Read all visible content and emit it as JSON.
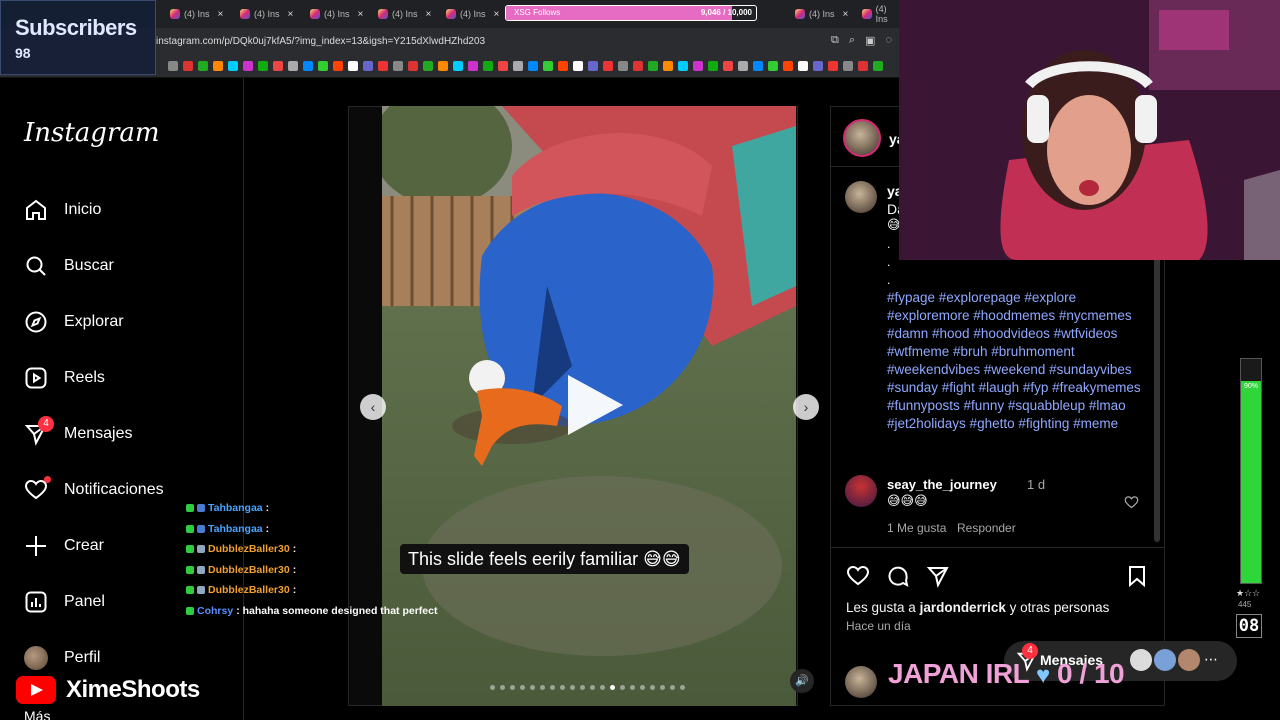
{
  "overlay": {
    "subscribers_label": "Subscribers",
    "subscribers_count": "98",
    "follows_goal_label": "XSG Follows",
    "follows_goal_value": "9,046 / 10,000",
    "follows_goal_fraction": 0.9046,
    "youtube_name": "XimeShoots",
    "japan_label": "JAPAN IRL",
    "japan_progress": "0 / 10",
    "meter_percent": "90%",
    "meter_value": "445",
    "meter_counter": "08"
  },
  "browser": {
    "tabs": [
      {
        "label": "(4) Ins"
      },
      {
        "label": "(4) Ins"
      },
      {
        "label": "(4) Ins"
      },
      {
        "label": "(4) Ins"
      },
      {
        "label": "(4) Ins"
      },
      {
        "label": "(4) Ins"
      },
      {
        "label": "(4) Ins"
      },
      {
        "label": "(4) Ins"
      },
      {
        "label": "(4) Ins"
      },
      {
        "label": "(4) Ins"
      }
    ],
    "url": "instagram.com/p/DQk0uj7kfA5/?img_index=13&igsh=Y215dXlwdHZhd203"
  },
  "sidebar": {
    "logo": "Instagram",
    "items": [
      {
        "label": "Inicio",
        "icon": "home-icon"
      },
      {
        "label": "Buscar",
        "icon": "search-icon"
      },
      {
        "label": "Explorar",
        "icon": "compass-icon"
      },
      {
        "label": "Reels",
        "icon": "reels-icon"
      },
      {
        "label": "Mensajes",
        "icon": "messenger-icon",
        "badge": "4"
      },
      {
        "label": "Notificaciones",
        "icon": "heart-icon"
      },
      {
        "label": "Crear",
        "icon": "plus-icon"
      },
      {
        "label": "Panel",
        "icon": "chart-icon"
      },
      {
        "label": "Perfil",
        "icon": "avatar"
      },
      {
        "label": "Más",
        "icon": "menu-icon"
      }
    ]
  },
  "chat": [
    {
      "user": "Tahbangaa",
      "text": ":",
      "color": "#4aa3ff"
    },
    {
      "user": "Tahbangaa",
      "text": ":",
      "color": "#4aa3ff"
    },
    {
      "user": "DubblezBaller30",
      "text": ":",
      "color": "#f0a030"
    },
    {
      "user": "DubblezBaller30",
      "text": ":",
      "color": "#f0a030"
    },
    {
      "user": "DubblezBaller30",
      "text": ":",
      "color": "#f0a030"
    },
    {
      "user": "Cohrsy",
      "text": ": hahaha someone designed that perfect",
      "color": "#5a8dff"
    }
  ],
  "post": {
    "caption_overlay": "This slide feels eerily familiar 😅😅",
    "author_short": "ya",
    "author_caption_short": "ya",
    "caption_start": "Da",
    "caption_emoji": "😅",
    "hashtags": "#fypage #explorepage #explore #exploremore #hoodmemes #nycmemes #damn #hood #hoodvideos #wtfvideos #wtfmeme #bruh #bruhmoment #weekendvibes #weekend #sundayvibes #sunday #fight #laugh #fyp #freakymemes #funnyposts #funny #squabbleup #lmao #jet2holidays #ghetto #fighting #meme",
    "comment": {
      "user": "seay_the_journey",
      "time": "1 d",
      "text": "😅😅😅",
      "likes": "1 Me gusta",
      "reply": "Responder"
    },
    "likes_text_prefix": "Les gusta a ",
    "likes_user": "jardonderrick",
    "likes_text_suffix": " y otras personas",
    "posted": "Hace un día",
    "messages_pill": "Mensajes",
    "messages_badge": "4"
  }
}
